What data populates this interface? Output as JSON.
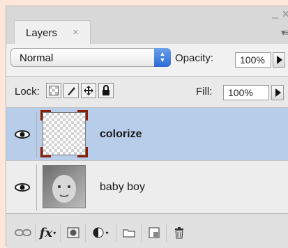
{
  "panel": {
    "tab_label": "Layers",
    "tab_close_glyph": "×",
    "window_minimize_glyph": "–",
    "window_close_glyph": "×",
    "panel_menu_glyph": "▾≡"
  },
  "blend_mode": {
    "selected": "Normal"
  },
  "opacity": {
    "label": "Opacity:",
    "value": "100%"
  },
  "lock": {
    "label": "Lock:",
    "buttons": [
      "lock-transparent-pixels-icon",
      "lock-image-pixels-icon",
      "lock-position-icon",
      "lock-all-icon"
    ]
  },
  "fill": {
    "label": "Fill:",
    "value": "100%"
  },
  "layers": [
    {
      "name": "colorize",
      "selected": true,
      "visible": true,
      "thumbnail": "transparent-checkerboard"
    },
    {
      "name": "baby boy",
      "selected": false,
      "visible": true,
      "thumbnail": "baby-photo"
    }
  ],
  "bottom_toolbar": {
    "buttons": [
      "link-layers-icon",
      "fx-layer-style-icon",
      "add-mask-icon",
      "adjustment-layer-icon",
      "new-group-folder-icon",
      "new-layer-icon",
      "trash-icon"
    ],
    "fx_label": "fx"
  },
  "colors": {
    "selected_row": "#b7cde9",
    "blend_arrow_accent": "#2c6bd6",
    "thumbnail_bracket": "#8a1e05",
    "page_background": "#fde7d9"
  }
}
